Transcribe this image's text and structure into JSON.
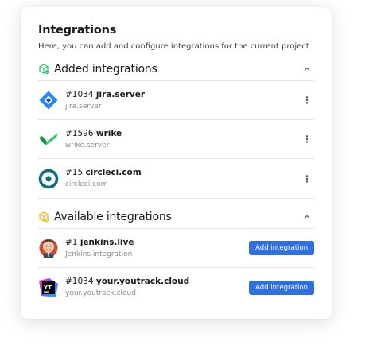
{
  "header": {
    "title": "Integrations",
    "subtitle": "Here, you can add and configure integrations for the current project"
  },
  "added": {
    "title": "Added integrations",
    "icon": "cube-check-icon",
    "items": [
      {
        "id": "#1034",
        "name": "jira.server",
        "detail": "jira.server",
        "icon": "jira-icon"
      },
      {
        "id": "#1596",
        "name": "wrike",
        "detail": "wrike.server",
        "icon": "wrike-icon"
      },
      {
        "id": "#15",
        "name": "circleci.com",
        "detail": "circleci.com",
        "icon": "circleci-icon"
      }
    ],
    "more_label": "⋮"
  },
  "available": {
    "title": "Available integrations",
    "icon": "cube-plus-icon",
    "items": [
      {
        "id": "#1",
        "name": "jenkins.live",
        "detail": "Jenkins integration",
        "icon": "jenkins-icon"
      },
      {
        "id": "#1034",
        "name": "your.youtrack.cloud",
        "detail": "your.youtrack.cloud",
        "icon": "youtrack-icon",
        "logo_text": "YT"
      }
    ],
    "button_label": "Add integration"
  },
  "colors": {
    "primary": "#2f6fe0",
    "jira": "#2684ff",
    "wrike": "#36a85a",
    "circleci": "#161616",
    "section_icon_added": "#3dbd7d",
    "section_icon_available": "#f2b705"
  }
}
